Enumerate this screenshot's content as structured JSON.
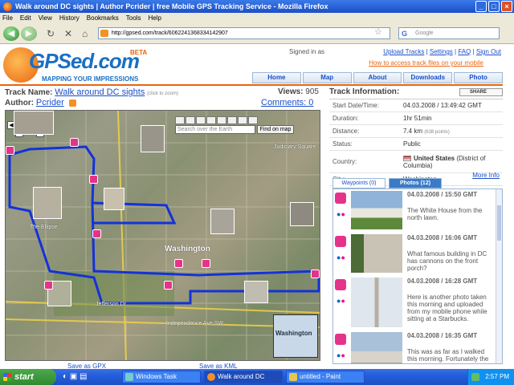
{
  "window": {
    "title": "Walk around DC sights | Author Pcrider | free Mobile GPS Tracking Service - Mozilla Firefox"
  },
  "menu": [
    "File",
    "Edit",
    "View",
    "History",
    "Bookmarks",
    "Tools",
    "Help"
  ],
  "nav": {
    "url": "http://gpsed.com/track/6062241368334142907",
    "search_placeholder": "Google"
  },
  "site": {
    "logo_text": "GPSed.com",
    "beta": "BETA",
    "tagline": "MAPPING YOUR IMPRESSIONS",
    "signed_in": "Signed in as",
    "links": [
      "Upload Tracks",
      "Settings",
      "FAQ",
      "Sign Out"
    ],
    "howto": "How to access track files on your mobile",
    "tabs": [
      "Home",
      "Map",
      "About",
      "Downloads",
      "Photo"
    ]
  },
  "track": {
    "name_label": "Track Name:",
    "name": "Walk around DC sights",
    "click_zoom": "(click to zoom)",
    "views_label": "Views:",
    "views": "905",
    "author_label": "Author:",
    "author": "Pcrider",
    "comments": "Comments: 0"
  },
  "map": {
    "search_placeholder": "Search over the Earth",
    "find_label": "Find on map",
    "label_washington": "Washington",
    "label_ellipse": "The Ellipse",
    "label_judiciary": "Judiciary Square",
    "label_independence": "Independence Ave SW",
    "label_jefferson": "Jefferson Dr",
    "inset_label": "Washington",
    "gpx_link": "Save as GPX",
    "kml_link": "Save as KML"
  },
  "info": {
    "title": "Track Information:",
    "share": "SHARE",
    "rows": [
      {
        "k": "Start Date/Time:",
        "v": "04.03.2008 / 13:49:42 GMT"
      },
      {
        "k": "Duration:",
        "v": "1hr 51min"
      },
      {
        "k": "Distance:",
        "v": "7.4 km",
        "extra": "(638 points)"
      },
      {
        "k": "Status:",
        "v": "Public"
      },
      {
        "k": "Country:",
        "v": "United States",
        "extra": "(District of Columbia)"
      },
      {
        "k": "City:",
        "v": "Washington"
      }
    ],
    "more_info": "More Info",
    "tab_waypoints": "Waypoints (0)",
    "tab_photos": "Photos (12)"
  },
  "photos": [
    {
      "date": "04.03.2008 / 15:50 GMT",
      "desc": "The White House from the north lawn."
    },
    {
      "date": "04.03.2008 / 16:06 GMT",
      "desc": "What famous building in DC has cannons on the front porch?"
    },
    {
      "date": "04.03.2008 / 16:28 GMT",
      "desc": "Here is another photo taken this morning and uploaded from my mobile phone while sitting at a Starbucks."
    },
    {
      "date": "04.03.2008 / 16:35 GMT",
      "desc": "This was as far as I walked this morning. Fortunately the rain held off."
    }
  ],
  "taskbar": {
    "start": "start",
    "tasks": [
      "Windows Task Manager",
      "Walk around DC sight...",
      "untitled - Paint"
    ],
    "clock": "2:57 PM"
  }
}
